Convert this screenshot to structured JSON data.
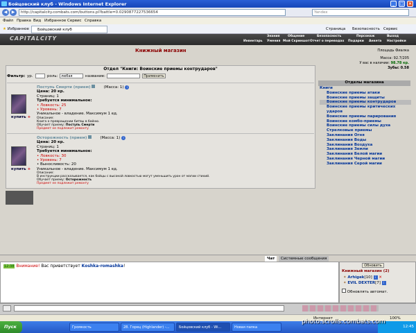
{
  "browser": {
    "title": "Бойцовский клуб - Windows Internet Explorer",
    "url": "http://capitalcity.combats.com/buttons.pl?battle=0.0290877227536654",
    "search_placeholder": "Yandex",
    "menu": [
      "Файл",
      "Правка",
      "Вид",
      "Избранное",
      "Сервис",
      "Справка"
    ],
    "favorites": "Избранное",
    "tab": "Бойцовский клуб",
    "toolbar_right": [
      "Страница",
      "Безопасность",
      "Сервис"
    ]
  },
  "game": {
    "logo": "CAPITALCITY",
    "menu_top": [
      "Знания",
      "Общение",
      "Безопасность",
      "Персонаж",
      "Выход"
    ],
    "menu_bottom": [
      "Инвентарь",
      "Умения",
      "Мой Скриншот",
      "Отчет о переводах",
      "Подарки",
      "Анкета",
      "Настройки"
    ]
  },
  "shop": {
    "title": "Книжный магазин",
    "location": "Площадь Фиалка",
    "mass": "Масса: 92.7/205",
    "money_label": "У вас в наличии:",
    "money": "98.78 кр.",
    "teeth": "Зубы: 0.58",
    "section": "Отдел \"Книги: Воинские приемы контрударов\"",
    "filter": {
      "label": "Фильтр:",
      "level": "ур.",
      "role": "роль:",
      "role_value": "любая",
      "name": "название:",
      "apply": "Применить"
    },
    "items": [
      {
        "name": "Поступь Смерти (прием)",
        "mass": "(Масса: 1)",
        "price": "Цена: 20 кр.",
        "pages": "Страниц: 1",
        "req_title": "Требуется минимальное:",
        "reqs": [
          {
            "text": "Ловкость: 25",
            "red": true
          },
          {
            "text": "Уровень: 7",
            "red": true
          }
        ],
        "unique": "Уникальное - владение. Максимум 1 ед.",
        "desc_label": "Описание:",
        "desc": "Книга о превращении битвы в бойню.",
        "teaches_label": "Обучает приему:",
        "teaches": "Поступь Смерти",
        "repair": "Предмет не подлежит ремонту",
        "buy": "купить"
      },
      {
        "name": "Осторожность (прием)",
        "mass": "(Масса: 1)",
        "price": "Цена: 20 кр.",
        "pages": "Страниц: 1",
        "req_title": "Требуется минимальное:",
        "reqs": [
          {
            "text": "Ловкость: 30",
            "red": true
          },
          {
            "text": "Уровень: 7",
            "red": true
          },
          {
            "text": "Выносливость: 20",
            "red": false
          }
        ],
        "unique": "Уникальное - владение. Максимум 1 ед.",
        "desc_label": "Описание:",
        "desc": "В инструкции рассказывается, как бойцы с высокой ловкостью могут уменьшить урон от магии стихий.",
        "teaches_label": "Обучает приему:",
        "teaches": "Осторожность",
        "repair": "Предмет не подлежит ремонту",
        "buy": "купить"
      }
    ],
    "departments": {
      "title": "Отделы магазина",
      "list": [
        {
          "text": "Книги",
          "cat": true
        },
        {
          "text": "Воинские приемы атаки"
        },
        {
          "text": "Воинские приемы защиты"
        },
        {
          "text": "Воинские приемы контрударов",
          "hi": true
        },
        {
          "text": "Воинские приемы критических ударов"
        },
        {
          "text": "Воинские приемы парирования"
        },
        {
          "text": "Воинские комбо-приемы"
        },
        {
          "text": "Воинские приемы силы духа"
        },
        {
          "text": "Стрелковые приемы"
        },
        {
          "text": "Заклинания Огня"
        },
        {
          "text": "Заклинания Воды"
        },
        {
          "text": "Заклинания Воздуха"
        },
        {
          "text": "Заклинания Земли"
        },
        {
          "text": "Заклинания Белой магии"
        },
        {
          "text": "Заклинания Черной магии"
        },
        {
          "text": "Заклинания Серой магии"
        }
      ]
    }
  },
  "chat": {
    "tabs": [
      "Чат",
      "Системные сообщения"
    ],
    "time": "12:38",
    "attention": "Внимание!",
    "msg": "Вас приветствует",
    "name": "Koshka-romashka",
    "end": "!"
  },
  "online": {
    "refresh": "Обновить",
    "title": "Книжный магазин (2)",
    "users": [
      {
        "name": "Arhigek",
        "lvl": "[10]"
      },
      {
        "name": "EVIL DEXTER",
        "lvl": "[7]"
      }
    ],
    "auto": "Обновлять автомат."
  },
  "statusbar": {
    "zone": "Интернет",
    "zoom": "100%"
  },
  "taskbar": {
    "start": "Пуск",
    "tasks": [
      "Громкость",
      "28. Горец (Highlander) -...",
      "Бойцовский клуб - Wi...",
      "Новая папка"
    ],
    "clock": "12:45"
  },
  "watermark": "photo.scrolls.combats.com"
}
